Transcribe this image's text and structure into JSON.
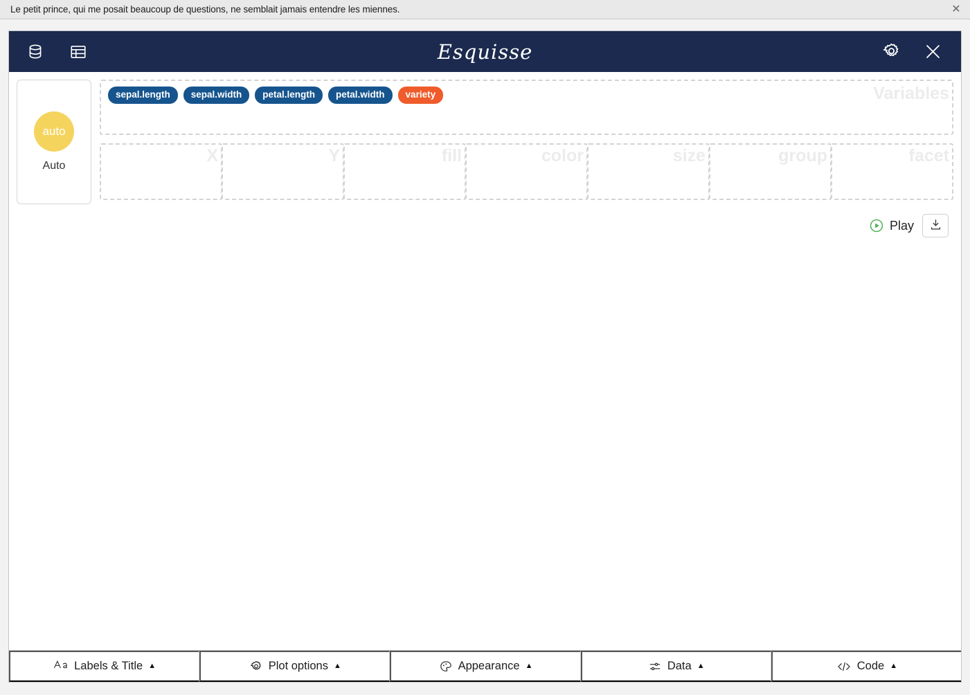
{
  "notification": {
    "message": "Le petit prince, qui me posait beaucoup de questions, ne semblait jamais entendre les miennes.",
    "close_label": "✕"
  },
  "header": {
    "title": "Esquisse",
    "left_icons": [
      {
        "name": "database-icon",
        "label": "Data"
      },
      {
        "name": "table-icon",
        "label": "Table"
      }
    ],
    "right_icons": [
      {
        "name": "gear-icon",
        "label": "Settings"
      },
      {
        "name": "close-icon",
        "label": "Close"
      }
    ]
  },
  "geometry": {
    "circle_text": "auto",
    "label": "Auto",
    "circle_color": "#f5d45e"
  },
  "variables": {
    "title": "Variables",
    "chips": [
      {
        "label": "sepal.length",
        "type": "numeric",
        "color": "#16548e"
      },
      {
        "label": "sepal.width",
        "type": "numeric",
        "color": "#16548e"
      },
      {
        "label": "petal.length",
        "type": "numeric",
        "color": "#16548e"
      },
      {
        "label": "petal.width",
        "type": "numeric",
        "color": "#16548e"
      },
      {
        "label": "variety",
        "type": "factor",
        "color": "#ef5b2b"
      }
    ]
  },
  "dropzones": [
    {
      "label": "X",
      "value": ""
    },
    {
      "label": "Y",
      "value": ""
    },
    {
      "label": "fill",
      "value": ""
    },
    {
      "label": "color",
      "value": ""
    },
    {
      "label": "size",
      "value": ""
    },
    {
      "label": "group",
      "value": ""
    },
    {
      "label": "facet",
      "value": ""
    }
  ],
  "actions": {
    "play_label": "Play",
    "play_icon": "play-circle-icon",
    "download_icon": "download-icon"
  },
  "bottom_bar": {
    "items": [
      {
        "icon": "aa-text-icon",
        "label": "Labels & Title",
        "caret": "▲"
      },
      {
        "icon": "gear-icon",
        "label": "Plot options",
        "caret": "▲"
      },
      {
        "icon": "palette-icon",
        "label": "Appearance",
        "caret": "▲"
      },
      {
        "icon": "sliders-icon",
        "label": "Data",
        "caret": "▲"
      },
      {
        "icon": "code-icon",
        "label": "Code",
        "caret": "▲"
      }
    ]
  },
  "colors": {
    "header_bg": "#1b2a4e",
    "chip_numeric": "#16548e",
    "chip_factor": "#ef5b2b",
    "accent_yellow": "#f5d45e",
    "play_green": "#4caf50"
  }
}
